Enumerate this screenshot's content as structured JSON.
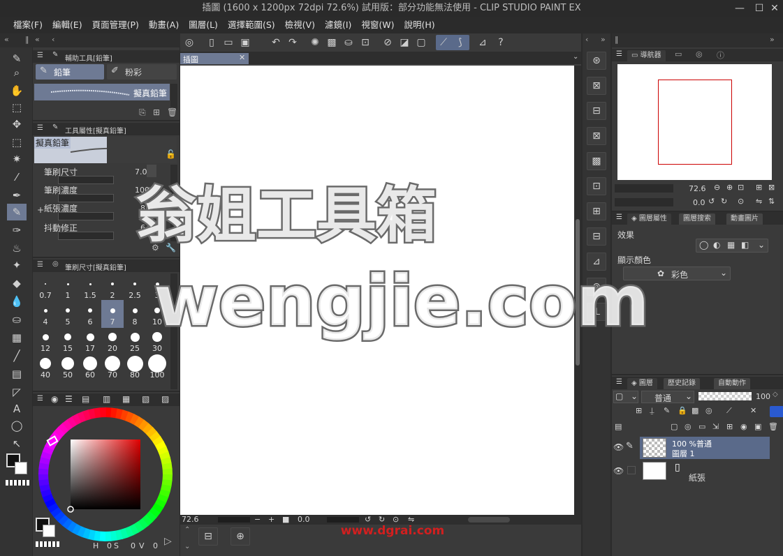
{
  "window": {
    "title": "插圖 (1600 x 1200px 72dpi 72.6%)  試用版：部分功能無法使用 - CLIP STUDIO PAINT EX"
  },
  "menu": [
    "檔案(F)",
    "編輯(E)",
    "頁面管理(P)",
    "動畫(A)",
    "圖層(L)",
    "選擇範圍(S)",
    "檢視(V)",
    "濾鏡(I)",
    "視窗(W)",
    "說明(H)"
  ],
  "subtool": {
    "header": "輔助工具[鉛筆]",
    "tab_pencil": "鉛筆",
    "tab_pastel": "粉彩",
    "brush_name": "擬真鉛筆"
  },
  "tool_props": {
    "header": "工具屬性[擬真鉛筆]",
    "brush_name": "擬真鉛筆",
    "rows": [
      {
        "label": "筆刷尺寸",
        "value": "7.0"
      },
      {
        "label": "筆刷濃度",
        "value": "100"
      },
      {
        "label": "紙張濃度",
        "value": "8"
      },
      {
        "label": "抖動修正",
        "value": "6"
      }
    ]
  },
  "brush_size": {
    "header": "筆刷尺寸[擬真鉛筆]",
    "sizes": [
      "0.7",
      "1",
      "1.5",
      "2",
      "2.5",
      "3",
      "4",
      "5",
      "6",
      "7",
      "8",
      "10",
      "12",
      "15",
      "17",
      "20",
      "25",
      "30",
      "40",
      "50",
      "60",
      "70",
      "80",
      "100"
    ],
    "selected": "7"
  },
  "color": {
    "readout": [
      "0",
      "0",
      "0"
    ]
  },
  "canvas": {
    "tab": "插圖",
    "zoom": "72.6",
    "angle": "0.0"
  },
  "navigator": {
    "header": "導航器",
    "zoom": "72.6",
    "angle": "0.0"
  },
  "layer_props": {
    "header": "圖層屬性",
    "tab2": "圖層搜索",
    "tab3": "動畫圖片",
    "effect_label": "效果",
    "display_color_label": "顯示顏色",
    "display_color_value": "彩色"
  },
  "layers": {
    "header": "圖層",
    "tab2": "歷史記錄",
    "tab3": "自動動作",
    "blend_mode": "普通",
    "opacity": "100",
    "items": [
      {
        "meta": "100 %普通",
        "name": "圖層 1"
      },
      {
        "name": "紙張"
      }
    ]
  },
  "watermark": {
    "line1": "翁姐工具箱",
    "line2": "wengjie.com",
    "footer": "www.dgrai.com"
  },
  "colors": {
    "selected_blue": "#6e7a94",
    "wm_red": "#d21f1f"
  }
}
